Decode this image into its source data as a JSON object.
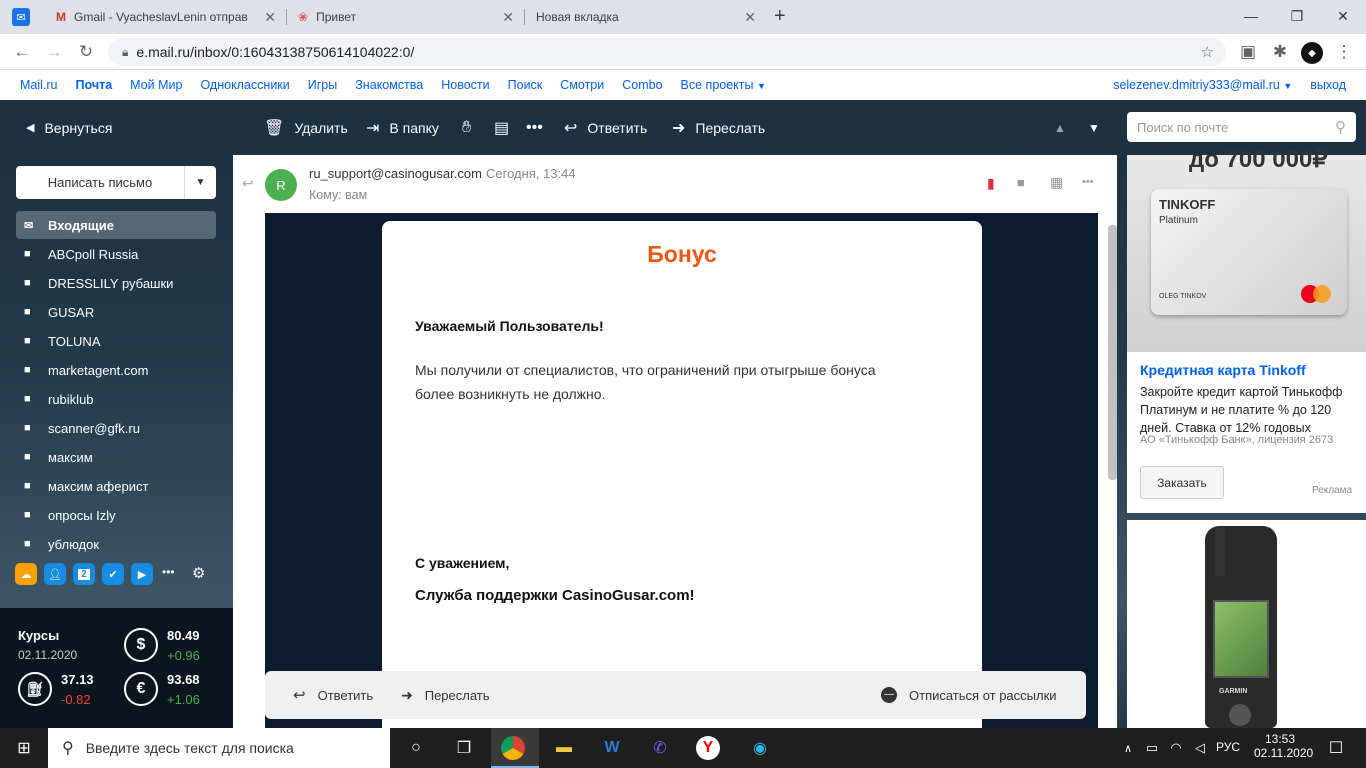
{
  "browser": {
    "tabs": [
      {
        "title": "Gmail - VyacheslavLenin отправ"
      },
      {
        "title": "Привет"
      },
      {
        "title": "Новая вкладка"
      }
    ],
    "url": "e.mail.ru/inbox/0:16043138750614104022:0/"
  },
  "portal": {
    "links": [
      "Mail.ru",
      "Почта",
      "Мой Мир",
      "Одноклассники",
      "Игры",
      "Знакомства",
      "Новости",
      "Поиск",
      "Смотри",
      "Combo",
      "Все проекты"
    ],
    "user": "selezenev.dmitriy333@mail.ru",
    "logout": "выход"
  },
  "toolbar": {
    "back": "Вернуться",
    "delete": "Удалить",
    "move": "В папку",
    "reply": "Ответить",
    "forward": "Переслать",
    "search_placeholder": "Поиск по почте"
  },
  "sidebar": {
    "compose": "Написать письмо",
    "folders": [
      "Входящие",
      "ABCpoll Russia",
      "DRESSLILY рубашки",
      "GUSAR",
      "TOLUNA",
      "marketagent.com",
      "rubiklub",
      "scanner@gfk.ru",
      "максим",
      "максим аферист",
      "опросы Izly",
      "ублюдок"
    ],
    "calendar_day": "2"
  },
  "rates": {
    "title": "Курсы",
    "date": "02.11.2020",
    "usd": {
      "value": "80.49",
      "change": "+0.96"
    },
    "oil": {
      "value": "37.13",
      "change": "-0.82"
    },
    "eur": {
      "value": "93.68",
      "change": "+1.06"
    }
  },
  "message": {
    "avatar_letter": "R",
    "from": "ru_support@casinogusar.com",
    "time": "Сегодня, 13:44",
    "to": "Кому: вам",
    "heading": "Бонус",
    "greeting": "Уважаемый Пользователь!",
    "body_line1": "Мы получили от специалистов, что ограничений при отыгрыше бонуса",
    "body_line2": "более возникнуть не должно.",
    "regards": "С уважением,",
    "signature": "Служба поддержки CasinoGusar.com!",
    "reply": "Ответить",
    "forward": "Переслать",
    "unsubscribe": "Отписаться от рассылки"
  },
  "ad": {
    "top_text": "до 700 000₽",
    "card_brand": "TINKOFF",
    "card_type": "Platinum",
    "card_holder": "OLEG TINKOV",
    "title": "Кредитная карта Tinkoff",
    "text": "Закройте кредит картой Тинькофф Платинум и не платите % до 120 дней. Ставка от 12% годовых",
    "legal": "АО «Тинькофф Банк», лицензия 2673",
    "button": "Заказать",
    "label": "Реклама",
    "gps_brand": "GARMIN"
  },
  "taskbar": {
    "search_placeholder": "Введите здесь текст для поиска",
    "lang": "РУС",
    "time": "13:53",
    "date": "02.11.2020"
  }
}
